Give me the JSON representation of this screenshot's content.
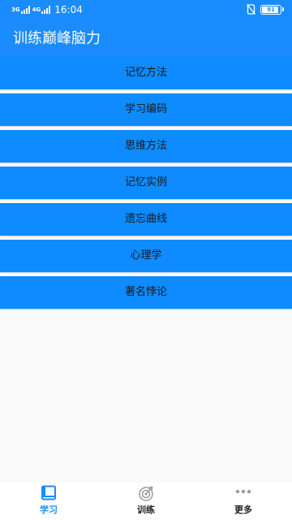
{
  "status_bar": {
    "network_1": "3G",
    "network_2": "4G",
    "time": "16:04",
    "battery": "91",
    "battery_level": 0.91,
    "icons": [
      "signal-icon",
      "silent-icon",
      "battery-icon"
    ]
  },
  "app_bar": {
    "title": "训练巅峰脑力"
  },
  "menu": {
    "items": [
      {
        "label": "记忆方法"
      },
      {
        "label": "学习编码"
      },
      {
        "label": "思维方法"
      },
      {
        "label": "记忆实例"
      },
      {
        "label": "遗忘曲线"
      },
      {
        "label": "心理学"
      },
      {
        "label": "著名悖论"
      }
    ]
  },
  "bottom_nav": {
    "tabs": [
      {
        "label": "学习",
        "icon": "book-icon",
        "active": true
      },
      {
        "label": "训练",
        "icon": "target-icon",
        "active": false
      },
      {
        "label": "更多",
        "icon": "more-dots-icon",
        "active": false
      }
    ]
  },
  "colors": {
    "primary": "#1a8cff",
    "menu_button": "#0d8bff",
    "menu_text": "#1a1a1a",
    "nav_active": "#1a8cff",
    "nav_inactive": "#222222",
    "background": "#fafafa"
  }
}
